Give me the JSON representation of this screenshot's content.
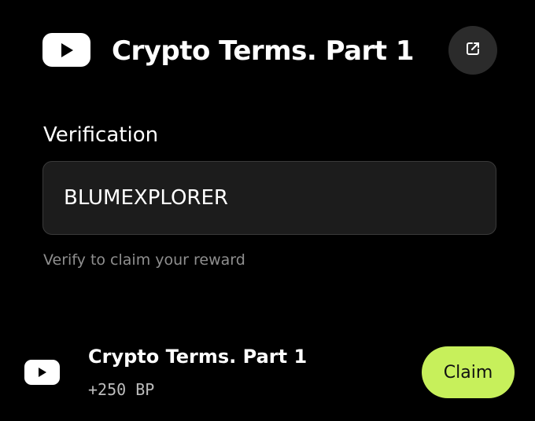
{
  "header": {
    "title": "Crypto Terms. Part 1",
    "logo_icon": "youtube-icon",
    "share_icon": "external-link-icon"
  },
  "verification": {
    "label": "Verification",
    "value": "BLUMEXPLORER",
    "hint": "Verify to claim your reward"
  },
  "task": {
    "icon": "youtube-icon",
    "title": "Crypto Terms. Part 1",
    "reward": "+250 BP",
    "button_label": "Claim"
  },
  "colors": {
    "background": "#000000",
    "accent": "#c7f05b",
    "input_bg": "#1c1c1c",
    "muted_text": "#8f8f8f"
  }
}
